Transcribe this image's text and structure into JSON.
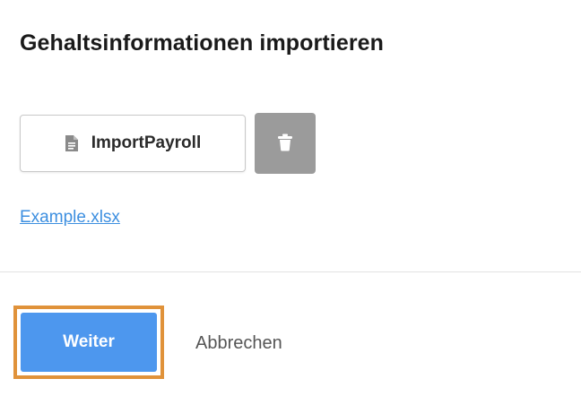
{
  "dialog": {
    "title": "Gehaltsinformationen importieren"
  },
  "file": {
    "name": "ImportPayroll",
    "icon": "document-icon",
    "delete_icon": "trash-icon"
  },
  "example_link": {
    "label": "Example.xlsx"
  },
  "actions": {
    "primary_label": "Weiter",
    "cancel_label": "Abbrechen"
  },
  "colors": {
    "primary": "#4d97ee",
    "link": "#3d8fe0",
    "highlight": "#e0923a",
    "delete_bg": "#9b9b9b"
  }
}
